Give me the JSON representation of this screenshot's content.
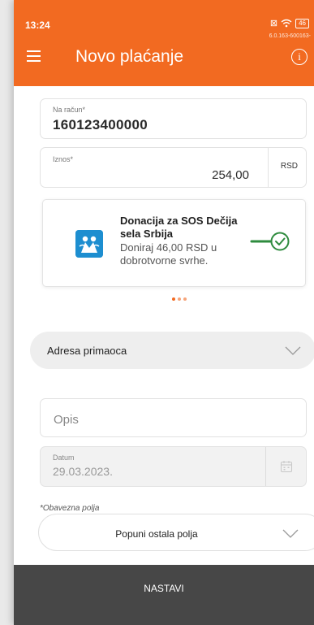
{
  "status_bar": {
    "time": "13:24",
    "network_badge": "⊠",
    "wifi_icon": "wifi-icon",
    "battery": "46",
    "version": "6.0.163-600163-"
  },
  "header": {
    "title": "Novo plaćanje",
    "menu_icon": "hamburger-icon",
    "info_icon": "info-icon",
    "info_glyph": "i",
    "background": "#f26a21"
  },
  "account_field": {
    "label": "Na račun*",
    "value": "160123400000"
  },
  "amount_field": {
    "label": "Iznos*",
    "value": "254,00",
    "currency": "RSD"
  },
  "donation_card": {
    "title": "Donacija za SOS Dečija sela Srbija",
    "description": "Doniraj 46,00 RSD u dobrotvorne svrhe.",
    "toggle_on": true
  },
  "pager": {
    "count": 3,
    "active": 0
  },
  "address_section": {
    "label": "Adresa primaoca"
  },
  "description_field": {
    "placeholder": "Opis"
  },
  "date_field": {
    "label": "Datum",
    "value": "29.03.2023."
  },
  "required_note": "*Obavezna polja",
  "fill_other": {
    "label": "Popuni ostala polja"
  },
  "primary_button": {
    "label": "NASTAVI",
    "background": "#474747"
  }
}
